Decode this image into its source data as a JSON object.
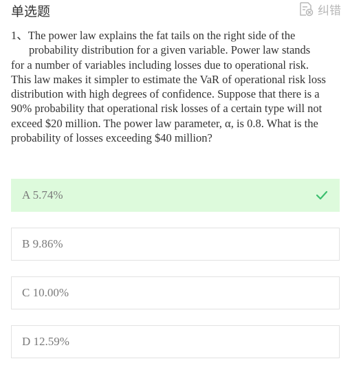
{
  "header": {
    "title": "单选题",
    "report_label": "纠错"
  },
  "question": {
    "number": "1、",
    "first_line": "The power law explains the fat tails on the right side of the",
    "second_line": "probability distribution for a given variable. Power law stands",
    "rest": "for a number of variables including losses due to operational risk. This law makes it simpler to estimate the VaR of operational risk loss distribution with high degrees of confidence. Suppose that there is a 90% probability that operational risk losses of a certain type will not exceed $20 million. The power law parameter, α, is 0.8. What is the probability of losses exceeding $40 million?"
  },
  "options": [
    {
      "label": "A 5.74%",
      "state": "correct"
    },
    {
      "label": "B 9.86%",
      "state": "default"
    },
    {
      "label": "C 10.00%",
      "state": "default"
    },
    {
      "label": "D 12.59%",
      "state": "default"
    }
  ],
  "colors": {
    "correct_bg": "#ddfadc",
    "check": "#3bbf6e",
    "border": "#e2e2e2"
  },
  "icons": {
    "report": "report-edit-icon",
    "check": "check-icon"
  }
}
